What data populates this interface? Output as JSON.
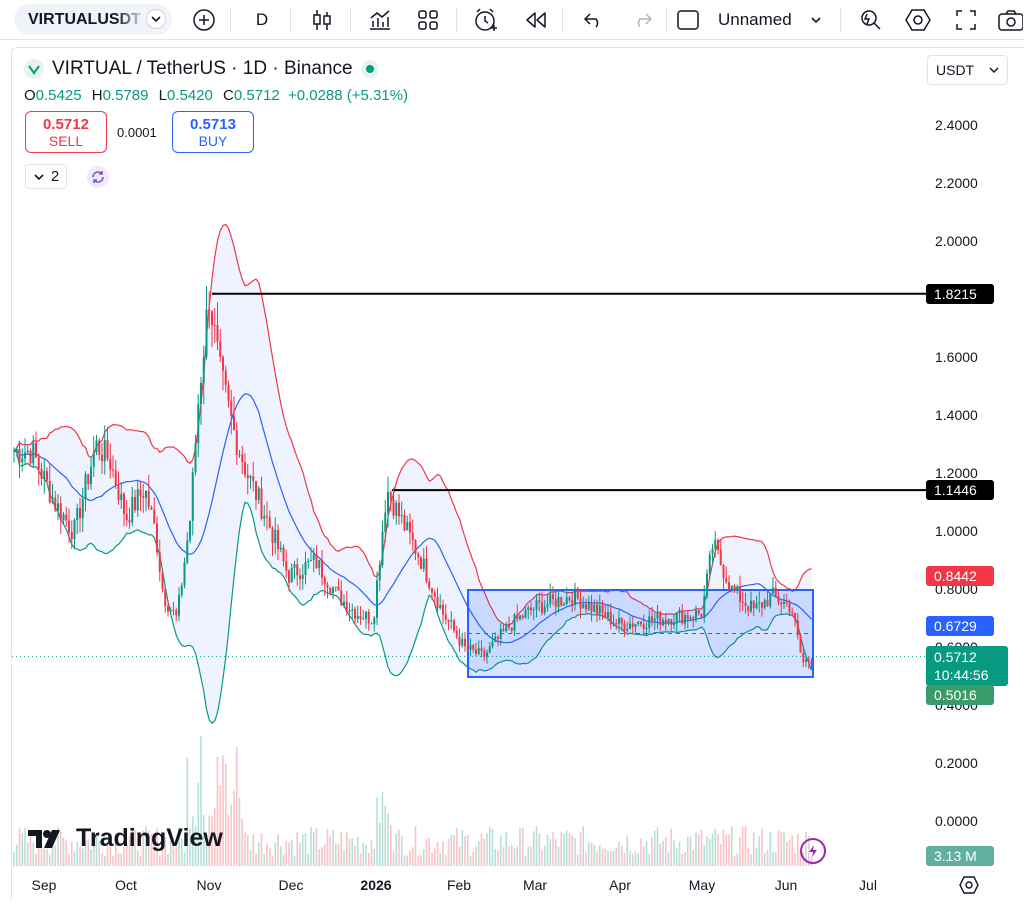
{
  "toolbar": {
    "symbol": "VIRTUALUSDT",
    "interval": "D",
    "layout_name": "Unnamed",
    "icons": [
      "plus-circle-icon",
      "candles-icon",
      "indicators-icon",
      "templates-icon",
      "alert-icon",
      "replay-icon",
      "undo-icon",
      "redo-icon",
      "layout-box-icon",
      "chevron-down-icon",
      "zoom-icon",
      "settings-icon",
      "fullscreen-icon",
      "snapshot-icon"
    ]
  },
  "legend": {
    "title": "VIRTUAL / TetherUS · 1D · Binance",
    "o_label": "O",
    "o_value": "0.5425",
    "h_label": "H",
    "h_value": "0.5789",
    "l_label": "L",
    "l_value": "0.5420",
    "c_label": "C",
    "c_value": "0.5712",
    "change": "+0.0288 (+5.31%)",
    "sell_price": "0.5712",
    "sell_label": "SELL",
    "spread": "0.0001",
    "buy_price": "0.5713",
    "buy_label": "BUY",
    "indicator_count": "2"
  },
  "currency": "USDT",
  "price_axis": [
    "2.4000",
    "2.2000",
    "2.0000",
    "1.8000",
    "1.6000",
    "1.4000",
    "1.2000",
    "1.0000",
    "0.8000",
    "0.6000",
    "0.4000",
    "0.2000",
    "0.0000"
  ],
  "price_tags": {
    "upper_line": "1.8215",
    "mid_line": "1.1446",
    "bb_upper": "0.8442",
    "bb_basis": "0.6729",
    "last_price": "0.5712",
    "countdown": "10:44:56",
    "bb_lower": "0.5016",
    "volume": "3.13 M"
  },
  "time_axis": [
    "Sep",
    "Oct",
    "Nov",
    "Dec",
    "2026",
    "Feb",
    "Mar",
    "Apr",
    "May",
    "Jun",
    "Jul"
  ],
  "branding": "TradingView",
  "colors": {
    "up": "#089981",
    "down": "#f23645",
    "bb_upper": "#f23645",
    "bb_basis": "#2962ff",
    "bb_lower": "#089981",
    "range_box": "#2962ff"
  },
  "chart_data": {
    "type": "candlestick",
    "ylim": [
      0.0,
      2.4
    ],
    "horizontal_lines": [
      1.8215,
      1.1446
    ],
    "range_box": {
      "top": 0.8,
      "bottom": 0.5,
      "from": "Feb",
      "to": "Jun"
    },
    "price_path": [
      [
        "Aug 28",
        1.28
      ],
      [
        "Sep 5",
        1.1
      ],
      [
        "Sep 12",
        1.0
      ],
      [
        "Sep 20",
        1.3
      ],
      [
        "Sep 25",
        1.25
      ],
      [
        "Oct 1",
        1.05
      ],
      [
        "Oct 8",
        1.15
      ],
      [
        "Oct 12",
        1.0
      ],
      [
        "Oct 15",
        0.78
      ],
      [
        "Oct 20",
        0.7
      ],
      [
        "Oct 25",
        1.05
      ],
      [
        "Oct 28",
        1.45
      ],
      [
        "Nov 1",
        1.82
      ],
      [
        "Nov 5",
        1.55
      ],
      [
        "Nov 10",
        1.35
      ],
      [
        "Nov 15",
        1.2
      ],
      [
        "Nov 22",
        1.05
      ],
      [
        "Nov 30",
        0.85
      ],
      [
        "Dec 10",
        0.9
      ],
      [
        "Dec 18",
        0.78
      ],
      [
        "Dec 25",
        0.72
      ],
      [
        "Dec 31",
        0.7
      ],
      [
        "Jan 5",
        1.15
      ],
      [
        "Jan 10",
        1.05
      ],
      [
        "Jan 18",
        0.9
      ],
      [
        "Jan 26",
        0.72
      ],
      [
        "Feb 3",
        0.6
      ],
      [
        "Feb 10",
        0.57
      ],
      [
        "Feb 20",
        0.68
      ],
      [
        "Mar 1",
        0.74
      ],
      [
        "Mar 15",
        0.78
      ],
      [
        "Apr 1",
        0.68
      ],
      [
        "Apr 15",
        0.7
      ],
      [
        "May 1",
        0.72
      ],
      [
        "May 5",
        0.96
      ],
      [
        "May 12",
        0.8
      ],
      [
        "May 20",
        0.73
      ],
      [
        "May 27",
        0.78
      ],
      [
        "Jun 3",
        0.74
      ],
      [
        "Jun 7",
        0.55
      ],
      [
        "Jun 12",
        0.57
      ]
    ]
  }
}
